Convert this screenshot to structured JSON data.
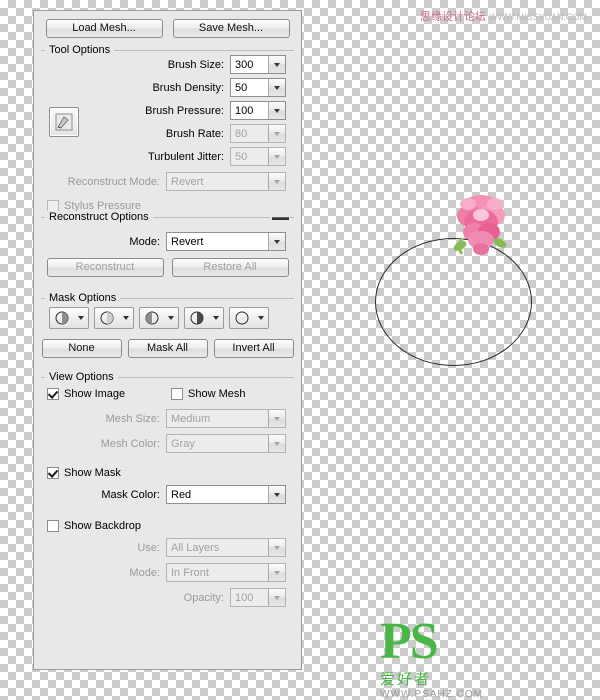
{
  "panel": {
    "top_buttons": [
      {
        "label": "Load Mesh...",
        "name": "load-mesh-button"
      },
      {
        "label": "Save Mesh...",
        "name": "save-mesh-button"
      }
    ],
    "tool_options": {
      "title": "Tool Options",
      "fields": [
        {
          "label": "Brush Size:",
          "value": "300"
        },
        {
          "label": "Brush Density:",
          "value": "50"
        },
        {
          "label": "Brush Pressure:",
          "value": "100"
        },
        {
          "label": "Brush Rate:",
          "value": "80"
        },
        {
          "label": "Turbulent Jitter:",
          "value": "50"
        }
      ],
      "reconstruct_mode_label": "Reconstruct Mode:",
      "reconstruct_mode_value": "Revert",
      "stylus_pressure_label": "Stylus Pressure"
    },
    "reconstruct_options": {
      "title": "Reconstruct Options",
      "mode_label": "Mode:",
      "mode_value": "Revert",
      "reconstruct_button": "Reconstruct",
      "restore_all_button": "Restore All"
    },
    "mask_options": {
      "title": "Mask Options",
      "buttons": [
        "None",
        "Mask All",
        "Invert All"
      ]
    },
    "view_options": {
      "title": "View Options",
      "show_image_label": "Show Image",
      "show_mesh_label": "Show Mesh",
      "mesh_size_label": "Mesh Size:",
      "mesh_size_value": "Medium",
      "mesh_color_label": "Mesh Color:",
      "mesh_color_value": "Gray",
      "show_mask_label": "Show Mask",
      "mask_color_label": "Mask Color:",
      "mask_color_value": "Red",
      "show_backdrop_label": "Show Backdrop",
      "use_label": "Use:",
      "use_value": "All Layers",
      "mode_label": "Mode:",
      "mode_value": "In Front",
      "opacity_label": "Opacity:",
      "opacity_value": "100"
    }
  },
  "watermarks": {
    "top_text": "思缘设计论坛",
    "top_site": "WWW.MISSYUAN.COM",
    "bottom_logo": "PS",
    "bottom_sub": "爱好者",
    "bottom_url": "WWW.PSAHZ.COM"
  },
  "colors": {
    "panel_bg": "#e8e8e8",
    "accent_green": "#4bb648",
    "watermark_pink": "#c86a8c"
  }
}
